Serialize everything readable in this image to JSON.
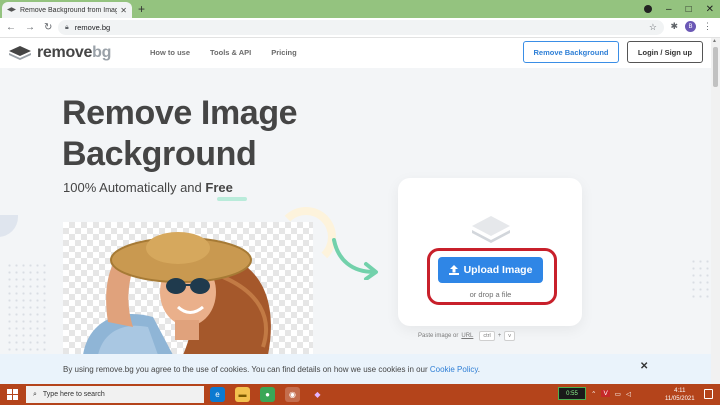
{
  "browser": {
    "tab_title": "Remove Background from Image",
    "tab_close": "✕",
    "new_tab": "+",
    "url": "remove.bg",
    "profile_initial": "B"
  },
  "header": {
    "logo_text_a": "remove",
    "logo_text_b": "bg",
    "nav": [
      "How to use",
      "Tools & API",
      "Pricing"
    ],
    "remove_bg_button": "Remove Background",
    "login_button": "Login / Sign up"
  },
  "hero": {
    "title_line1": "Remove Image",
    "title_line2": "Background",
    "subtitle_prefix": "100% Automatically and",
    "subtitle_free": "Free"
  },
  "upload": {
    "button_label": "Upload Image",
    "drop_text": "or drop a file",
    "paste_text": "Paste image or",
    "paste_url": "URL",
    "shortcut_ctrl": "ctrl",
    "shortcut_plus": "+",
    "shortcut_v": "v"
  },
  "cookie": {
    "text": "By using remove.bg you agree to the use of cookies. You can find details on how we use cookies in our",
    "link": "Cookie Policy",
    "period": ".",
    "close": "✕"
  },
  "taskbar": {
    "search_placeholder": "Type here to search",
    "battery": "0:55",
    "time": "4:11",
    "date": "11/05/2021"
  },
  "colors": {
    "accent_blue": "#2f86e6",
    "highlight_red": "#c8202b",
    "taskbar": "#b4441b",
    "chrome_frame": "#94c37f"
  }
}
